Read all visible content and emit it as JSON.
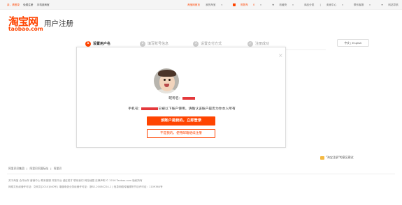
{
  "topbar": {
    "left": {
      "greeting": "亲，请登录",
      "register": "免费注册",
      "mobile": "手机逛淘宝"
    },
    "right": {
      "taobao_home": "淘宝网首页",
      "my_taobao": "我的淘宝",
      "cart": "购物车",
      "cart_count": "0",
      "favorites": "收藏夹",
      "categories": "商品分类",
      "seller_center": "卖家中心",
      "contact": "联系客服",
      "site_nav": "网站导航"
    }
  },
  "header": {
    "logo_cn": "淘宝网",
    "logo_en": "taobao.com",
    "title": "用户注册"
  },
  "steps": [
    {
      "num": "1",
      "label": "设置用户名"
    },
    {
      "num": "2",
      "label": "填写账号信息"
    },
    {
      "num": "3",
      "label": "设置支付方式"
    },
    {
      "num": "",
      "label": "注册成功"
    }
  ],
  "lang": {
    "label": "中文 | English"
  },
  "modal": {
    "close": "×",
    "name_prefix": "昵称名：",
    "phone_prefix": "手机号：",
    "phone_suffix": "已被以下账户使用，请确认该账户是否为你本人所有",
    "login_button": "该账户是我的，立即登录",
    "not_me_button": "不是我的，使用邮箱继续注册"
  },
  "feedback": {
    "label": "\"淘宝注册\"的意见建议"
  },
  "footer": {
    "row1": [
      "阿里巴巴集团",
      "|",
      "阿里巴巴国际站",
      "|",
      "阿里巴"
    ],
    "row2": "关于淘宝  合作伙伴  营销中心  联系客服  开放平台  诚征英才  联系我们  网站地图  法律声明     © 2016 Taobao.com 版权所有",
    "row3": "网络文化经营许可证：文网文[2010]040号  |  增值电信业务经营许可证：浙B2-20080224-1  |  信息网络传播视听节目许可证：1109364号"
  }
}
